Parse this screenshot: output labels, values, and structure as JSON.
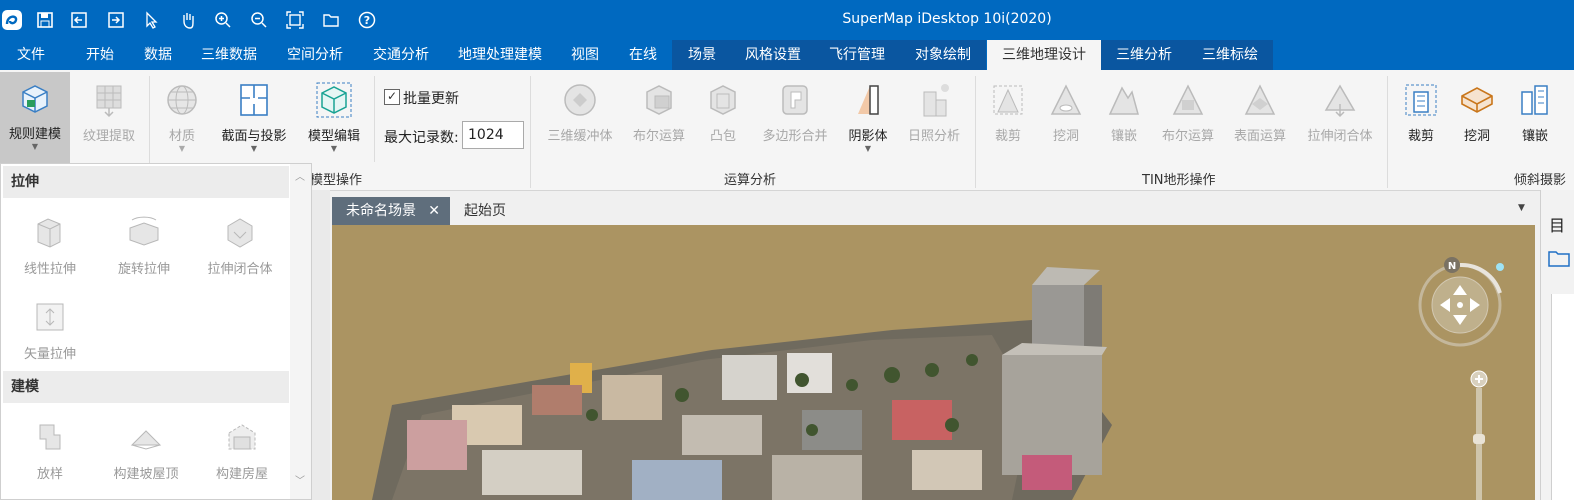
{
  "app_title": "SuperMap iDesktop 10i(2020)",
  "quick_access_icons": [
    "app-logo-icon",
    "save-icon",
    "import-icon",
    "export-icon",
    "select-pointer-icon",
    "pan-hand-icon",
    "zoom-in-icon",
    "zoom-out-icon",
    "full-extent-icon",
    "open-folder-icon",
    "help-icon"
  ],
  "menu_tabs": [
    {
      "label": "文件"
    },
    {
      "label": "开始"
    },
    {
      "label": "数据"
    },
    {
      "label": "三维数据"
    },
    {
      "label": "空间分析"
    },
    {
      "label": "交通分析"
    },
    {
      "label": "地理处理建模"
    },
    {
      "label": "视图"
    },
    {
      "label": "在线"
    },
    {
      "label": "场景"
    },
    {
      "label": "风格设置"
    },
    {
      "label": "飞行管理"
    },
    {
      "label": "对象绘制"
    },
    {
      "label": "三维地理设计"
    },
    {
      "label": "三维分析"
    },
    {
      "label": "三维标绘"
    }
  ],
  "active_tab": "三维地理设计",
  "ribbon": {
    "model_ops": {
      "rule_modeling": "规则建模",
      "texture_extract": "纹理提取",
      "material": "材质",
      "section_projection": "截面与投影",
      "model_edit": "模型编辑",
      "batch_update_label": "批量更新",
      "batch_update_checked": true,
      "max_records_label": "最大记录数:",
      "max_records_value": "1024",
      "group_label": "模型操作"
    },
    "calc_analysis": {
      "buffer3d": "三维缓冲体",
      "boolean": "布尔运算",
      "convex_hull": "凸包",
      "polygon_merge": "多边形合并",
      "shadow_volume": "阴影体",
      "sunlight": "日照分析",
      "group_label": "运算分析"
    },
    "tin_ops": {
      "clip": "裁剪",
      "dig": "挖洞",
      "inlay": "镶嵌",
      "boolean": "布尔运算",
      "surface": "表面运算",
      "stretch_closed": "拉伸闭合体",
      "group_label": "TIN地形操作"
    },
    "oblique": {
      "clip": "裁剪",
      "dig": "挖洞",
      "inlay": "镶嵌",
      "group_label": "倾斜摄影"
    }
  },
  "dropdown": {
    "sections": [
      {
        "title": "拉伸",
        "items": [
          "线性拉伸",
          "旋转拉伸",
          "拉伸闭合体",
          "矢量拉伸"
        ]
      },
      {
        "title": "建模",
        "items": [
          "放样",
          "构建坡屋顶",
          "构建房屋"
        ]
      }
    ]
  },
  "doc_tabs": [
    {
      "label": "未命名场景",
      "active": true
    },
    {
      "label": "起始页",
      "active": false
    }
  ],
  "colors": {
    "titlebar": "#0069c0",
    "context_tabs": "#0a56a0",
    "scene_bg": "#ab9462"
  }
}
